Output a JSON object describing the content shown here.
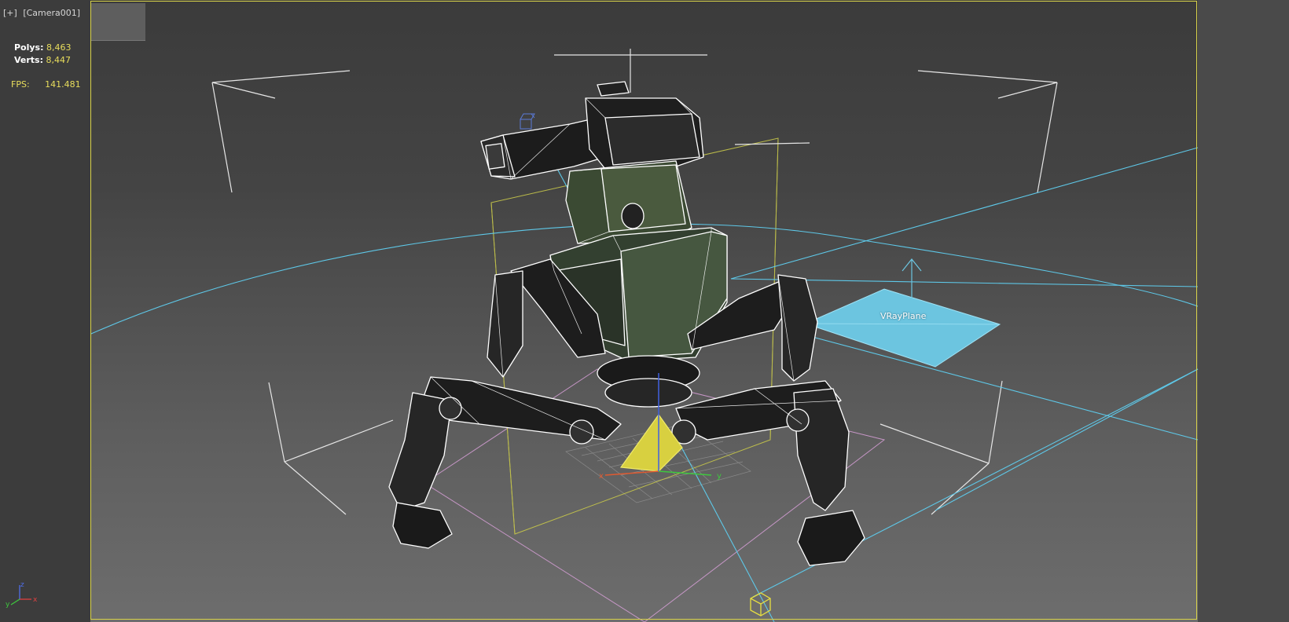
{
  "viewport": {
    "menu_plus": "[+]",
    "camera_name": "[Camera001]"
  },
  "stats": {
    "polys_label": "Polys:",
    "polys_value": "8,463",
    "verts_label": "Verts:",
    "verts_value": "8,447",
    "fps_label": "FPS:",
    "fps_value": "141.481"
  },
  "scene": {
    "vray_plane_label": "VRayPlane",
    "gizmo_axes": {
      "x": "x",
      "y": "y"
    },
    "corner_axes": {
      "x": "x",
      "y": "y",
      "z": "z"
    }
  },
  "colors": {
    "frame": "#d8d24a",
    "wire": "#ffffff",
    "light": "#5ec8e8",
    "bbox_yellow": "#c8c84a",
    "bbox_pink": "#d8a0d8",
    "gizmo": "#e8e040",
    "stat_value": "#e8dd5c"
  },
  "icons": [
    "axis-tripod-icon",
    "gizmo-cube-icon",
    "light-target-icon"
  ]
}
